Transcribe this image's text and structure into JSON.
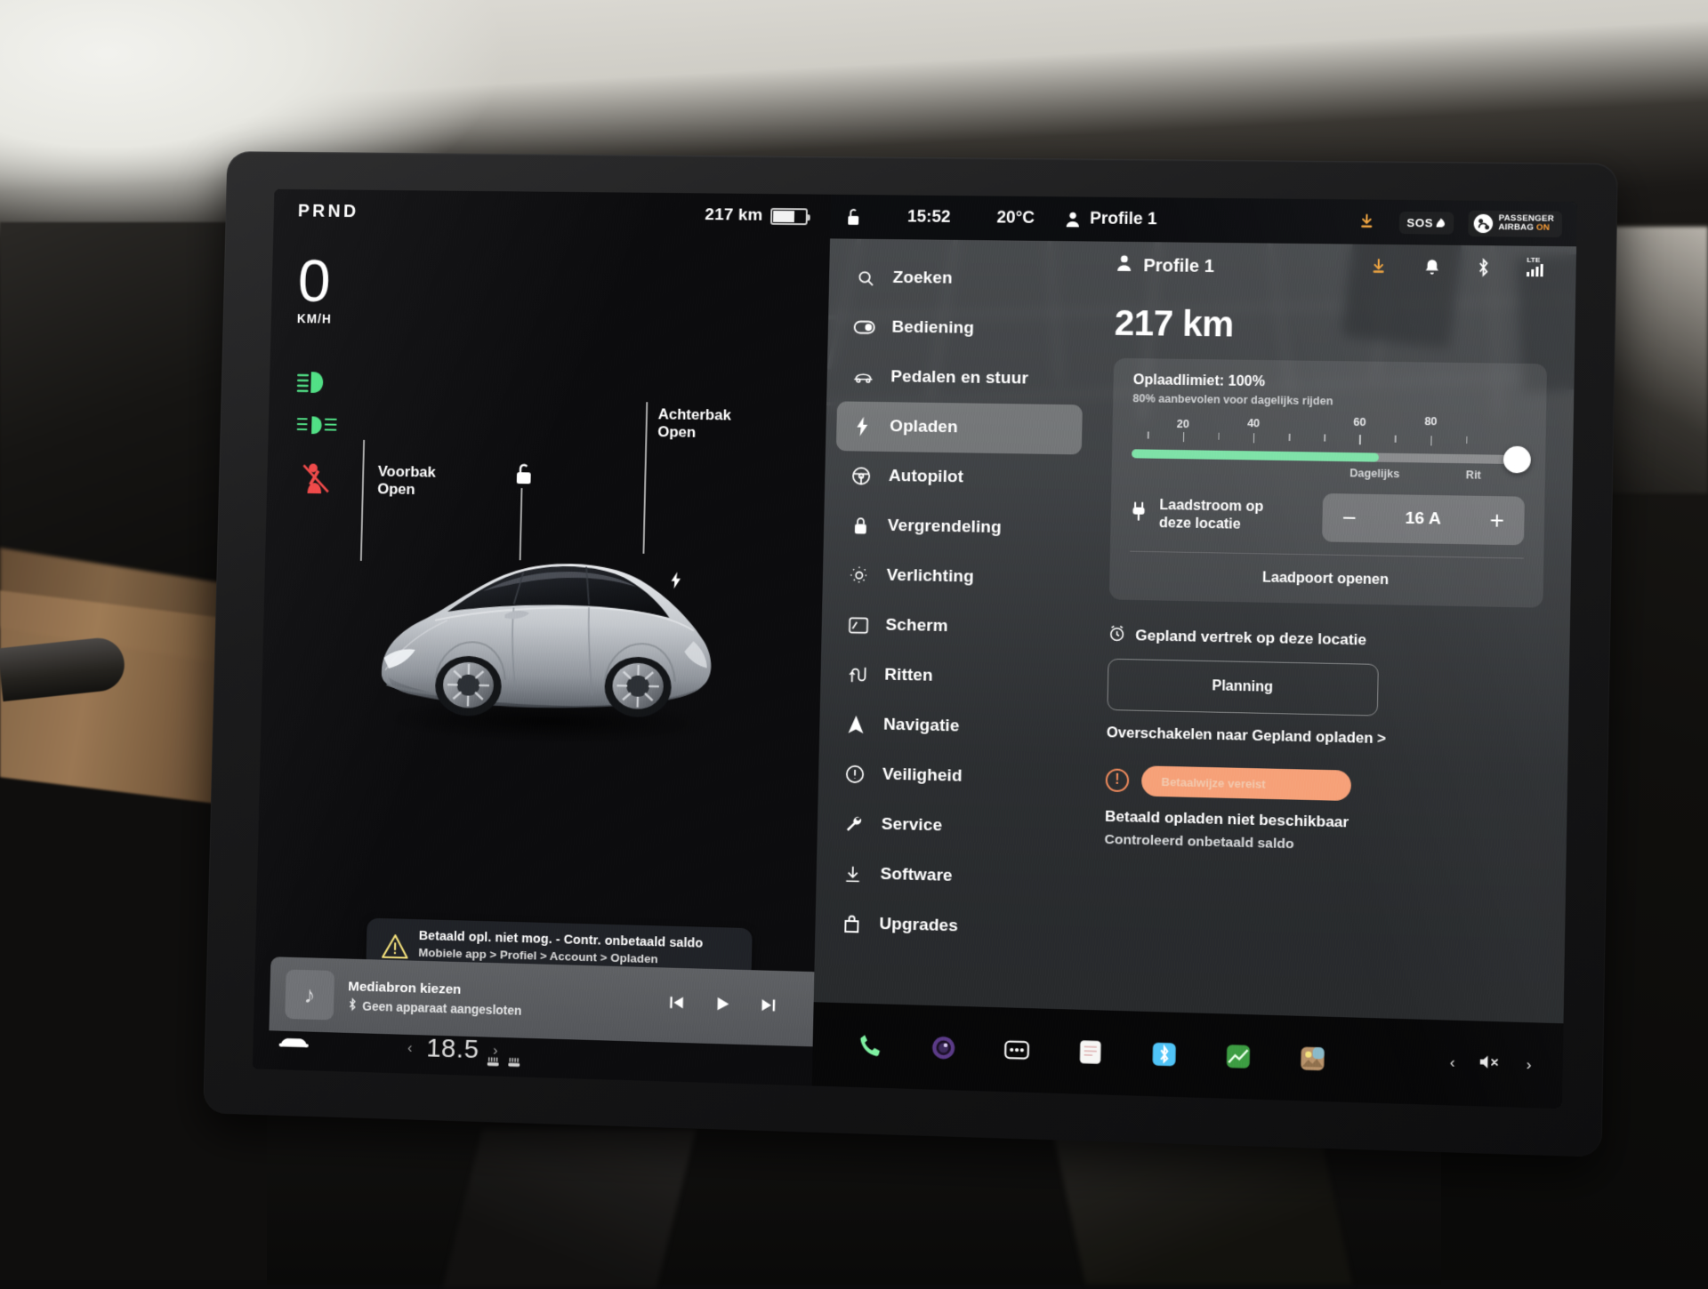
{
  "instrument": {
    "gear_indicator": "PRND",
    "speed_value": "0",
    "speed_unit": "KM/H",
    "telltales": [
      {
        "name": "low-beam-headlight-icon",
        "color": "#4ade80"
      },
      {
        "name": "front-fog-light-icon",
        "color": "#4ade80"
      },
      {
        "name": "seatbelt-warning-icon",
        "color": "#ef4444"
      }
    ],
    "callouts": [
      {
        "name": "frunk-open-callout",
        "line1": "Voorbak",
        "line2": "Open"
      },
      {
        "name": "trunk-open-callout",
        "line1": "Achterbak",
        "line2": "Open"
      }
    ],
    "unlock_icon": "unlocked-padlock-icon",
    "charge_port_icon": "charge-bolt-icon"
  },
  "statusbar": {
    "range": "217 km",
    "battery_level_pct": 62,
    "lock_icon": "unlocked-padlock-icon",
    "time": "15:52",
    "temperature": "20°C",
    "profile_icon": "person-icon",
    "profile_name": "Profile 1",
    "download_icon": "software-download-icon",
    "sos_label": "SOS",
    "airbag_line1": "PASSENGER",
    "airbag_line2": "AIRBAG",
    "airbag_state": "ON",
    "airbag_state_color": "#ff9b2e"
  },
  "vehicle_alert": {
    "icon": "warning-triangle-icon",
    "title": "Betaald opl. niet mog. - Contr. onbetaald saldo",
    "subtitle": "Mobiele app > Profiel > Account > Opladen"
  },
  "media": {
    "art_icon": "music-note-icon",
    "title": "Mediabron kiezen",
    "bluetooth_icon": "bluetooth-icon",
    "subtitle": "Geen apparaat aangesloten",
    "prev_icon": "skip-previous-icon",
    "play_icon": "play-icon",
    "next_icon": "skip-next-icon"
  },
  "climate": {
    "car_icon": "car-front-icon",
    "prev_icon": "chevron-left-icon",
    "temperature": "18.5",
    "next_icon": "chevron-right-icon",
    "seat_heater_left_icon": "seat-heater-icon",
    "seat_heater_right_icon": "seat-heater-icon"
  },
  "settings": {
    "sidebar": [
      {
        "label": "Zoeken",
        "icon": "search-icon",
        "active": false
      },
      {
        "label": "Bediening",
        "icon": "toggle-icon",
        "active": false
      },
      {
        "label": "Pedalen en stuur",
        "icon": "car-side-icon",
        "active": false
      },
      {
        "label": "Opladen",
        "icon": "charge-bolt-icon",
        "active": true
      },
      {
        "label": "Autopilot",
        "icon": "steering-wheel-icon",
        "active": false
      },
      {
        "label": "Vergrendeling",
        "icon": "lock-icon",
        "active": false
      },
      {
        "label": "Verlichting",
        "icon": "sun-brightness-icon",
        "active": false
      },
      {
        "label": "Scherm",
        "icon": "display-icon",
        "active": false
      },
      {
        "label": "Ritten",
        "icon": "trip-route-icon",
        "active": false
      },
      {
        "label": "Navigatie",
        "icon": "navigation-arrow-icon",
        "active": false
      },
      {
        "label": "Veiligheid",
        "icon": "exclamation-circle-icon",
        "active": false
      },
      {
        "label": "Service",
        "icon": "wrench-icon",
        "active": false
      },
      {
        "label": "Software",
        "icon": "download-icon",
        "active": false
      },
      {
        "label": "Upgrades",
        "icon": "shopping-bag-icon",
        "active": false
      }
    ],
    "header": {
      "profile_icon": "person-icon",
      "profile_name": "Profile 1",
      "icons": [
        "software-download-icon",
        "bell-icon",
        "bluetooth-icon",
        "cellular-signal-icon"
      ],
      "network_label": "LTE",
      "download_icon_color": "#f0a23c"
    },
    "charging": {
      "range_big": "217 km",
      "limit_title": "Oplaadlimiet: 100%",
      "limit_subtitle": "80% aanbevolen voor dagelijks rijden",
      "slider_value": 100,
      "slider_min": 0,
      "slider_max": 100,
      "slider_fill_pct": 63,
      "slider_fill_color": "#7de2a7",
      "tick_labels": [
        "20",
        "40",
        "60",
        "80"
      ],
      "zone_label_daily": "Dagelijks",
      "zone_label_trip": "Rit",
      "amp_icon": "charge-plug-icon",
      "amp_label_line1": "Laadstroom op",
      "amp_label_line2": "deze locatie",
      "amp_minus": "−",
      "amp_value": "16 A",
      "amp_plus": "+",
      "open_port_label": "Laadpoort openen"
    },
    "scheduled": {
      "icon": "alarm-clock-icon",
      "title": "Gepland vertrek op deze locatie",
      "plan_button": "Planning",
      "switch_link": "Overschakelen naar Gepland opladen >"
    },
    "payment": {
      "icon": "exclamation-circle-icon",
      "pill_label": "Betaalwijze vereist",
      "pill_color": "#f6a077",
      "line1": "Betaald opladen niet beschikbaar",
      "line2": "Controleerd onbetaald saldo"
    }
  },
  "dock": {
    "apps": [
      {
        "name": "phone-app-icon",
        "glyph": "phone",
        "color": "#7df0a0"
      },
      {
        "name": "camera-app-icon",
        "glyph": "camera",
        "color": "#9b6fd6"
      },
      {
        "name": "more-apps-icon",
        "glyph": "dots",
        "color": "#ffffff"
      },
      {
        "name": "notes-app-icon",
        "glyph": "notes",
        "color": "#f4f4f4"
      },
      {
        "name": "bluetooth-app-icon",
        "glyph": "bt",
        "color": "#4fc3f7"
      },
      {
        "name": "energy-app-icon",
        "glyph": "chart",
        "color": "#4caf50"
      },
      {
        "name": "gallery-app-icon",
        "glyph": "gallery",
        "color": "#c79a6b"
      }
    ],
    "volume_prev_icon": "chevron-left-icon",
    "mute_icon": "volume-mute-icon",
    "volume_next_icon": "chevron-right-icon"
  }
}
